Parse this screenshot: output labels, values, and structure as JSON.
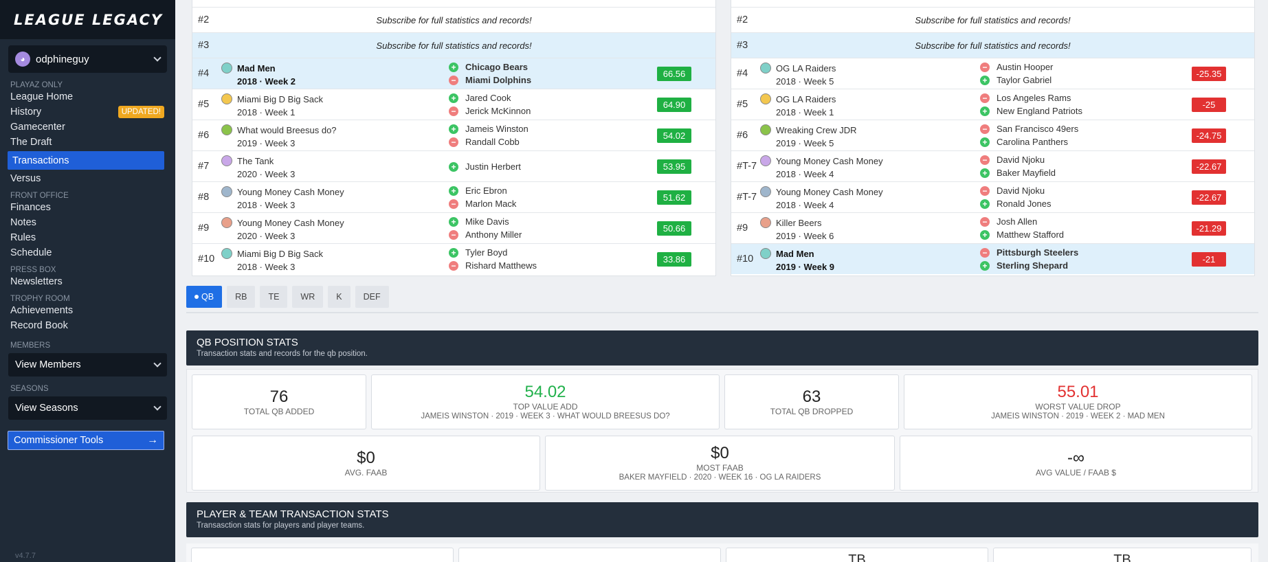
{
  "sidebar": {
    "logo": "LEAGUE LEGACY",
    "user": {
      "name": "odphineguy",
      "avatar_initial": "◕"
    },
    "sections": {
      "playaz_only": "PLAYAZ ONLY",
      "front_office": "FRONT OFFICE",
      "press_box": "PRESS BOX",
      "trophy_room": "TROPHY ROOM",
      "members": "MEMBERS",
      "seasons": "SEASONS"
    },
    "nav": {
      "league_home": "League Home",
      "history": "History",
      "history_badge": "UPDATED!",
      "gamecenter": "Gamecenter",
      "the_draft": "The Draft",
      "transactions": "Transactions",
      "versus": "Versus",
      "finances": "Finances",
      "notes": "Notes",
      "rules": "Rules",
      "schedule": "Schedule",
      "newsletters": "Newsletters",
      "achievements": "Achievements",
      "record_book": "Record Book"
    },
    "view_members": "View Members",
    "view_seasons": "View Seasons",
    "commissioner_tools": "Commissioner Tools",
    "version": "v4.7.7"
  },
  "left_board": {
    "locked": [
      {
        "rank": "#2",
        "msg": "Subscribe for full statistics and records!"
      },
      {
        "rank": "#3",
        "msg": "Subscribe for full statistics and records!"
      }
    ],
    "rows": [
      {
        "rank": "#4",
        "team": "Mad Men",
        "when": "2018 · Week 2",
        "add": "Chicago Bears",
        "drop": "Miami Dolphins",
        "value": "66.56"
      },
      {
        "rank": "#5",
        "team": "Miami Big D Big Sack",
        "when": "2018 · Week 1",
        "add": "Jared Cook",
        "drop": "Jerick McKinnon",
        "value": "64.90"
      },
      {
        "rank": "#6",
        "team": "What would Breesus do?",
        "when": "2019 · Week 3",
        "add": "Jameis Winston",
        "drop": "Randall Cobb",
        "value": "54.02"
      },
      {
        "rank": "#7",
        "team": "The Tank",
        "when": "2020 · Week 3",
        "add": "Justin Herbert",
        "drop": "",
        "value": "53.95"
      },
      {
        "rank": "#8",
        "team": "Young Money Cash Money",
        "when": "2018 · Week 3",
        "add": "Eric Ebron",
        "drop": "Marlon Mack",
        "value": "51.62"
      },
      {
        "rank": "#9",
        "team": "Young Money Cash Money",
        "when": "2020 · Week 3",
        "add": "Mike Davis",
        "drop": "Anthony Miller",
        "value": "50.66"
      },
      {
        "rank": "#10",
        "team": "Miami Big D Big Sack",
        "when": "2018 · Week 3",
        "add": "Tyler Boyd",
        "drop": "Rishard Matthews",
        "value": "33.86"
      }
    ]
  },
  "right_board": {
    "locked": [
      {
        "rank": "#2",
        "msg": "Subscribe for full statistics and records!"
      },
      {
        "rank": "#3",
        "msg": "Subscribe for full statistics and records!"
      }
    ],
    "rows": [
      {
        "rank": "#4",
        "team": "OG LA Raiders",
        "when": "2018 · Week 5",
        "add": "Taylor Gabriel",
        "drop": "Austin Hooper",
        "value": "-25.35"
      },
      {
        "rank": "#5",
        "team": "OG LA Raiders",
        "when": "2018 · Week 1",
        "add": "New England Patriots",
        "drop": "Los Angeles Rams",
        "value": "-25"
      },
      {
        "rank": "#6",
        "team": "Wreaking Crew JDR",
        "when": "2019 · Week 5",
        "add": "Carolina Panthers",
        "drop": "San Francisco 49ers",
        "value": "-24.75"
      },
      {
        "rank": "#T-7",
        "team": "Young Money Cash Money",
        "when": "2018 · Week 4",
        "add": "Baker Mayfield",
        "drop": "David Njoku",
        "value": "-22.67"
      },
      {
        "rank": "#T-7",
        "team": "Young Money Cash Money",
        "when": "2018 · Week 4",
        "add": "Ronald Jones",
        "drop": "David Njoku",
        "value": "-22.67"
      },
      {
        "rank": "#9",
        "team": "Killer Beers",
        "when": "2019 · Week 6",
        "add": "Matthew Stafford",
        "drop": "Josh Allen",
        "value": "-21.29"
      },
      {
        "rank": "#10",
        "team": "Mad Men",
        "when": "2019 · Week 9",
        "add": "Sterling Shepard",
        "drop": "Pittsburgh Steelers",
        "value": "-21"
      }
    ]
  },
  "position_tabs": [
    "QB",
    "RB",
    "TE",
    "WR",
    "K",
    "DEF"
  ],
  "active_tab": "QB",
  "qb_section": {
    "title": "QB POSITION STATS",
    "subtitle": "Transaction stats and records for the qb position."
  },
  "stats": {
    "total_added": {
      "value": "76",
      "label": "TOTAL QB ADDED"
    },
    "top_value_add": {
      "value": "54.02",
      "label": "TOP VALUE ADD",
      "sub": "JAMEIS WINSTON · 2019 · WEEK 3 · WHAT WOULD BREESUS DO?"
    },
    "total_dropped": {
      "value": "63",
      "label": "TOTAL QB DROPPED"
    },
    "worst_value_drop": {
      "value": "55.01",
      "label": "WORST VALUE DROP",
      "sub": "JAMEIS WINSTON · 2019 · WEEK 2 · MAD MEN"
    },
    "avg_faab": {
      "value": "$0",
      "label": "AVG. FAAB"
    },
    "most_faab": {
      "value": "$0",
      "label": "MOST FAAB",
      "sub": "BAKER MAYFIELD · 2020 · WEEK 16 · OG LA RAIDERS"
    },
    "avg_value_faab": {
      "value": "-∞",
      "label": "AVG VALUE / FAAB $"
    }
  },
  "player_team_section": {
    "title": "PLAYER & TEAM TRANSACTION STATS",
    "subtitle": "Transasction stats for players and player teams."
  },
  "bottom_cards": [
    "",
    "",
    "TB",
    "TB"
  ],
  "colors": {
    "accent": "#1f5fd8",
    "positive": "#1fb043",
    "negative": "#e23131",
    "sidebar": "#1f2a37",
    "highlight_row": "#dff0fb"
  }
}
